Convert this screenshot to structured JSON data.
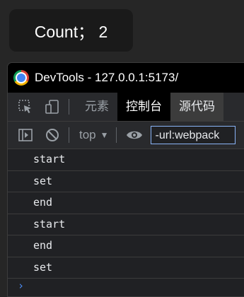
{
  "counter": {
    "text": "Count； 2"
  },
  "devtools": {
    "window_title": "DevTools - 127.0.0.1:5173/",
    "tabs": [
      {
        "label": "元素"
      },
      {
        "label": "控制台"
      },
      {
        "label": "源代码"
      }
    ],
    "toolbar": {
      "context": "top",
      "filter_value": "-url:webpack"
    },
    "console_lines": [
      "start",
      "set",
      "end",
      "start",
      "end",
      "set"
    ],
    "prompt_symbol": "›"
  },
  "colors": {
    "accent": "#8ab4f8",
    "prompt": "#4c8df6"
  }
}
